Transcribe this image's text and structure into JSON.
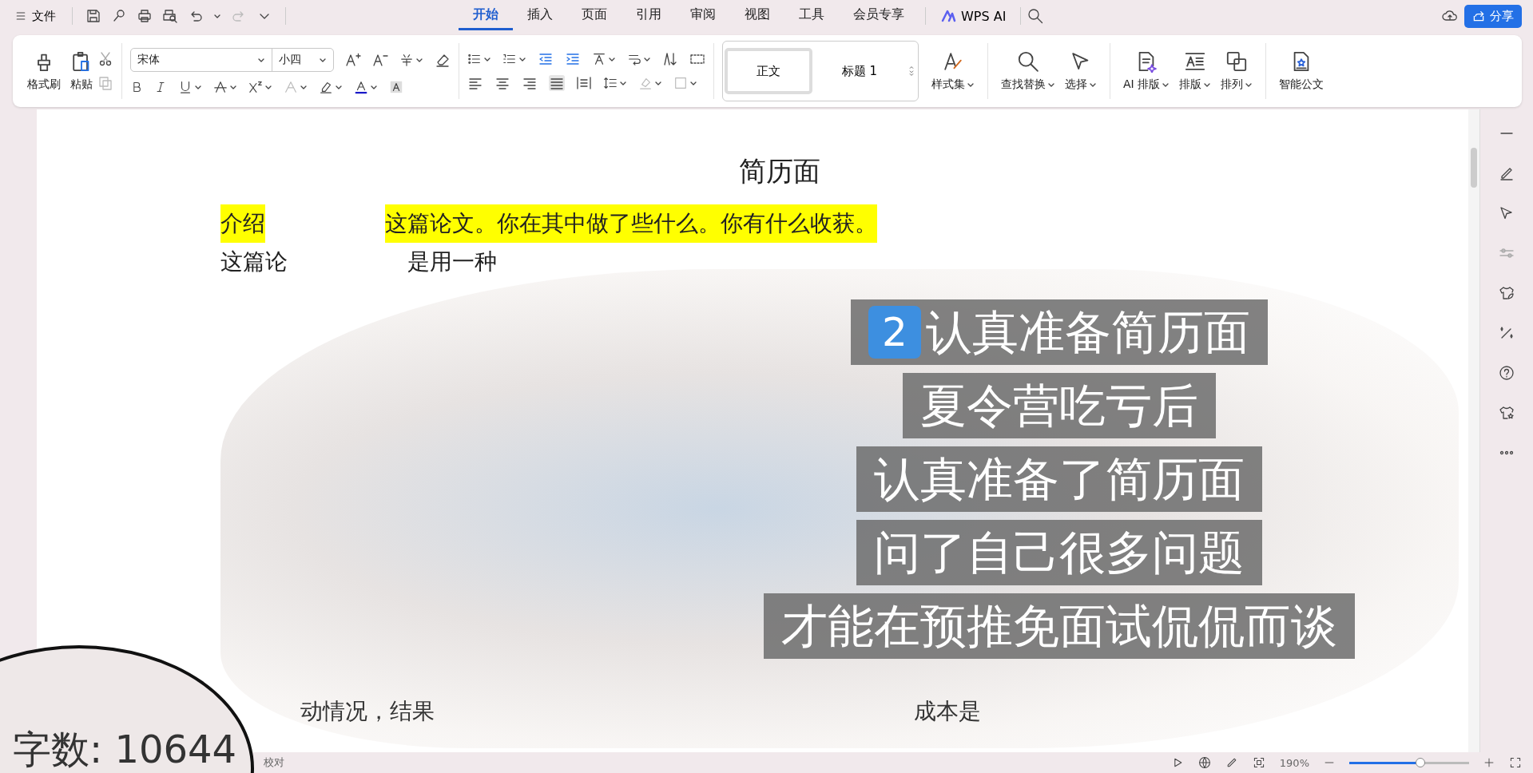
{
  "menu": {
    "file_label": "文件"
  },
  "tabs": [
    {
      "label": "开始",
      "selected": true
    },
    {
      "label": "插入",
      "selected": false
    },
    {
      "label": "页面",
      "selected": false
    },
    {
      "label": "引用",
      "selected": false
    },
    {
      "label": "审阅",
      "selected": false
    },
    {
      "label": "视图",
      "selected": false
    },
    {
      "label": "工具",
      "selected": false
    },
    {
      "label": "会员专享",
      "selected": false
    }
  ],
  "wps_ai": "WPS AI",
  "share": "分享",
  "ribbon": {
    "format_painter": "格式刷",
    "paste": "粘贴",
    "font": "宋体",
    "font_size": "小四",
    "styles": [
      {
        "label": "正文",
        "selected": true
      },
      {
        "label": "标题 1",
        "selected": false
      }
    ],
    "style_set": "样式集",
    "tools": [
      {
        "label": "查找替换"
      },
      {
        "label": "选择"
      },
      {
        "label": "AI 排版"
      },
      {
        "label": "排版"
      },
      {
        "label": "排列"
      },
      {
        "label": "智能公文"
      }
    ]
  },
  "document": {
    "title": "简历面",
    "lines": [
      {
        "kind": "highlight",
        "parts": [
          "介绍",
          "这篇论文。你在其中做了些什么。你有什么收获。"
        ]
      },
      {
        "kind": "plain",
        "parts": [
          "这篇论",
          "是用一种"
        ]
      }
    ],
    "footer_parts": [
      "动情况，结果",
      "成本是"
    ]
  },
  "captions": [
    {
      "badge": "2",
      "text": "认真准备简历面"
    },
    {
      "text": "夏令营吃亏后"
    },
    {
      "text": "认真准备了简历面"
    },
    {
      "text": "问了自己很多问题"
    },
    {
      "text": "才能在预推免面试侃侃而谈"
    }
  ],
  "magnifier": {
    "text": "字数: 10644"
  },
  "status_bar": {
    "left": "校对",
    "zoom": "190%",
    "level": 0.6
  }
}
